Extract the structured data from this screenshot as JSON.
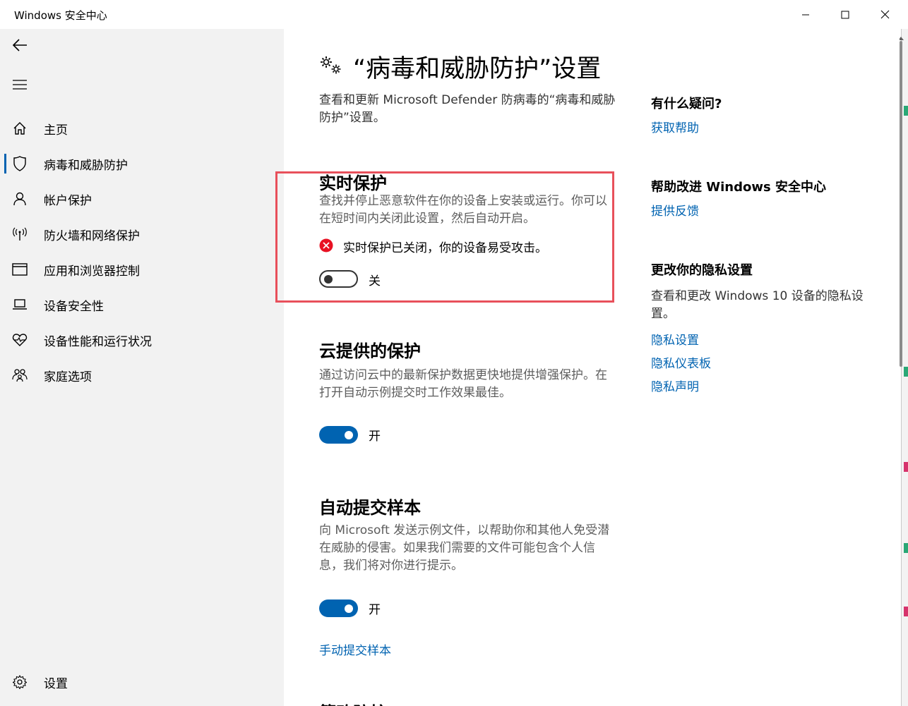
{
  "window": {
    "title": "Windows 安全中心",
    "minimize_icon": "minimize-icon",
    "maximize_icon": "maximize-icon",
    "close_icon": "close-icon"
  },
  "sidebar": {
    "back_icon": "back-arrow-icon",
    "menu_icon": "hamburger-menu-icon",
    "items": [
      {
        "label": "主页",
        "icon": "home-icon",
        "active": false
      },
      {
        "label": "病毒和威胁防护",
        "icon": "shield-icon",
        "active": true
      },
      {
        "label": "帐户保护",
        "icon": "person-icon",
        "active": false
      },
      {
        "label": "防火墙和网络保护",
        "icon": "wireless-icon",
        "active": false
      },
      {
        "label": "应用和浏览器控制",
        "icon": "browser-window-icon",
        "active": false
      },
      {
        "label": "设备安全性",
        "icon": "laptop-icon",
        "active": false
      },
      {
        "label": "设备性能和运行状况",
        "icon": "heart-pulse-icon",
        "active": false
      },
      {
        "label": "家庭选项",
        "icon": "family-icon",
        "active": false
      }
    ],
    "settings": {
      "label": "设置",
      "icon": "gear-icon"
    }
  },
  "main": {
    "title_icon": "gears-icon",
    "title": "“病毒和威胁防护”设置",
    "description": "查看和更新 Microsoft Defender 防病毒的“病毒和威胁防护”设置。",
    "realtime": {
      "title": "实时保护",
      "description": "查找并停止恶意软件在你的设备上安装或运行。你可以在短时间内关闭此设置，然后自动开启。",
      "warning_icon": "error-x-icon",
      "warning": "实时保护已关闭，你的设备易受攻击。",
      "toggle_state": "off",
      "toggle_label": "关",
      "highlight_color": "#e8505b"
    },
    "cloud": {
      "title": "云提供的保护",
      "description": "通过访问云中的最新保护数据更快地提供增强保护。在打开自动示例提交时工作效果最佳。",
      "toggle_state": "on",
      "toggle_label": "开"
    },
    "sample": {
      "title": "自动提交样本",
      "description": "向 Microsoft 发送示例文件，以帮助你和其他人免受潜在威胁的侵害。如果我们需要的文件可能包含个人信息，我们将对你进行提示。",
      "toggle_state": "on",
      "toggle_label": "开",
      "manual_link": "手动提交样本"
    },
    "next_section_title": "篡改防护"
  },
  "right": {
    "question": {
      "heading": "有什么疑问?",
      "link": "获取帮助"
    },
    "improve": {
      "heading": "帮助改进 Windows 安全中心",
      "link": "提供反馈"
    },
    "privacy": {
      "heading": "更改你的隐私设置",
      "text": "查看和更改 Windows 10 设备的隐私设置。",
      "links": [
        "隐私设置",
        "隐私仪表板",
        "隐私声明"
      ]
    }
  },
  "colors": {
    "accent": "#0063b1",
    "sidebar_bg": "#f2f2f2",
    "error": "#e81123"
  }
}
